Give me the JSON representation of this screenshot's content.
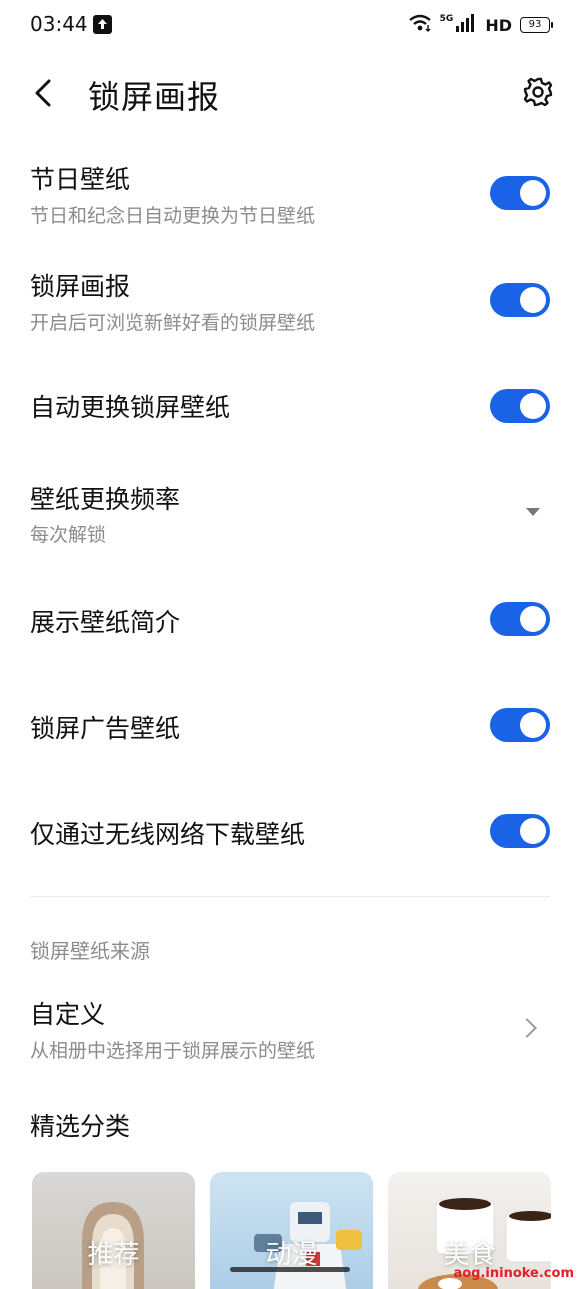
{
  "status_bar": {
    "time": "03:44",
    "network": "5G",
    "hd": "HD",
    "battery": "93"
  },
  "header": {
    "title": "锁屏画报",
    "icons": {
      "back": "chevron-left-icon",
      "settings": "gear-icon"
    }
  },
  "settings": [
    {
      "title": "节日壁纸",
      "subtitle": "节日和纪念日自动更换为节日壁纸",
      "control": "toggle",
      "on": true
    },
    {
      "title": "锁屏画报",
      "subtitle": "开启后可浏览新鲜好看的锁屏壁纸",
      "control": "toggle",
      "on": true
    },
    {
      "title": "自动更换锁屏壁纸",
      "control": "toggle",
      "on": true
    },
    {
      "title": "壁纸更换频率",
      "subtitle": "每次解锁",
      "control": "dropdown"
    },
    {
      "title": "展示壁纸简介",
      "control": "toggle",
      "on": true
    },
    {
      "title": "锁屏广告壁纸",
      "control": "toggle",
      "on": true
    },
    {
      "title": "仅通过无线网络下载壁纸",
      "control": "toggle",
      "on": true
    }
  ],
  "source_section": {
    "label": "锁屏壁纸来源",
    "custom": {
      "title": "自定义",
      "subtitle": "从相册中选择用于锁屏展示的壁纸"
    }
  },
  "categories": {
    "heading": "精选分类",
    "items": [
      {
        "label": "推荐"
      },
      {
        "label": "动漫"
      },
      {
        "label": "美食"
      }
    ]
  },
  "watermark": "aog.ininoke.com",
  "colors": {
    "accent": "#1a63e6",
    "subtitle": "#8c8c8c"
  }
}
